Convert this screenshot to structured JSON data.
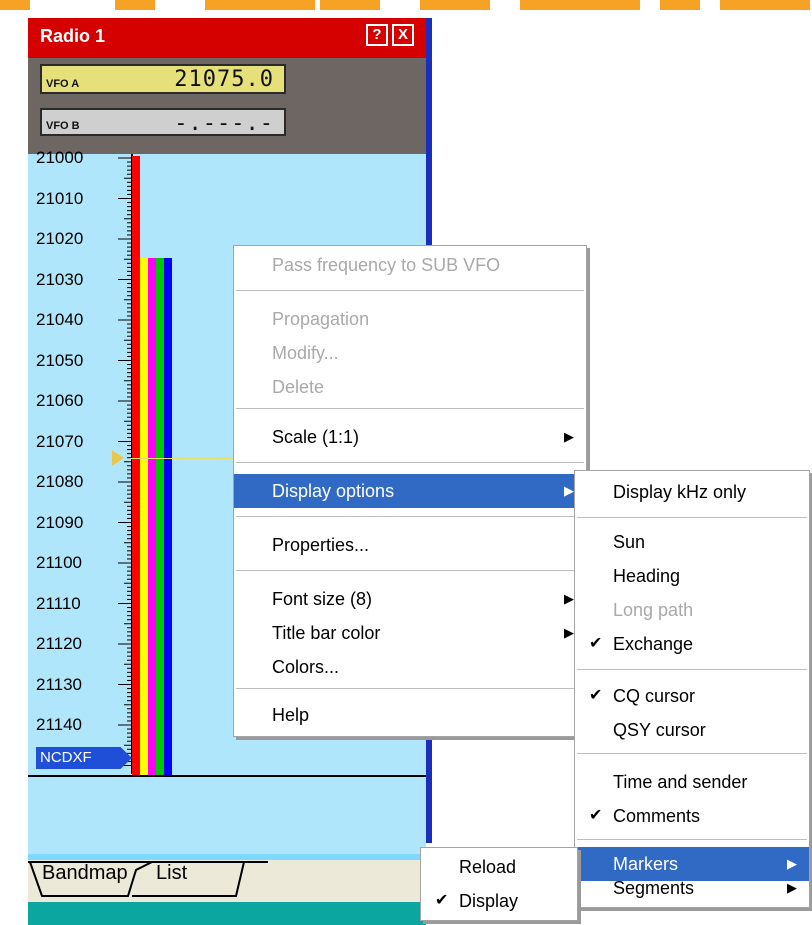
{
  "window": {
    "title": "Radio 1",
    "help_btn": "?",
    "close_btn": "X"
  },
  "vfo": {
    "a_label": "VFO A",
    "a_value": "21075.0",
    "a_color": "#e6e07a",
    "b_label": "VFO B",
    "b_value": "-.---.-",
    "b_color": "#cfcfcf"
  },
  "bandmap": {
    "scale": [
      "21000",
      "21010",
      "21020",
      "21030",
      "21040",
      "21050",
      "21060",
      "21070",
      "21080",
      "21090",
      "21100",
      "21110",
      "21120",
      "21130",
      "21140"
    ],
    "marker_label": "NCDXF",
    "band_colors": [
      "#ff0000",
      "#ffff00",
      "#ff00ff",
      "#00c800",
      "#0000ff"
    ]
  },
  "tabs": {
    "bandmap": "Bandmap",
    "list": "List"
  },
  "context_menu": {
    "pass_freq": "Pass frequency to SUB VFO",
    "propagation": "Propagation",
    "modify": "Modify...",
    "delete": "Delete",
    "scale": "Scale (1:1)",
    "display_options": "Display options",
    "properties": "Properties...",
    "font_size": "Font size (8)",
    "title_bar_color": "Title bar color",
    "colors": "Colors...",
    "help": "Help"
  },
  "display_submenu": {
    "khz_only": "Display kHz only",
    "sun": "Sun",
    "heading": "Heading",
    "long_path": "Long path",
    "exchange": "Exchange",
    "cq_cursor": "CQ cursor",
    "qsy_cursor": "QSY cursor",
    "time_sender": "Time and sender",
    "comments": "Comments",
    "markers": "Markers",
    "segments": "Segments"
  },
  "markers_submenu": {
    "reload": "Reload",
    "display": "Display"
  },
  "glyphs": {
    "arrow": "▶",
    "check": "✔"
  }
}
